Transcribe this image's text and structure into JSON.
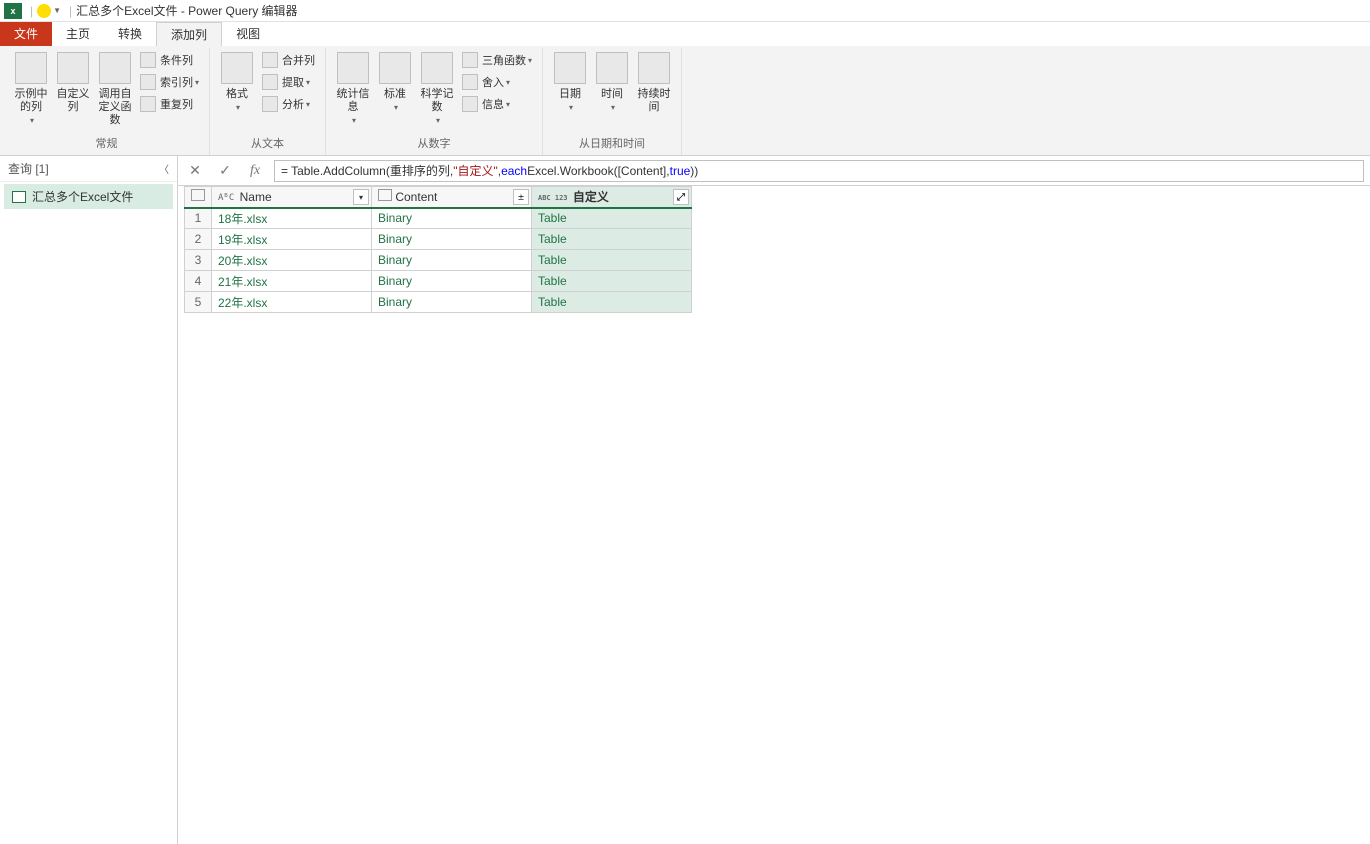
{
  "title": {
    "app_icon": "x",
    "window": "汇总多个Excel文件 - Power Query 编辑器"
  },
  "tabs": {
    "file": "文件",
    "home": "主页",
    "transform": "转换",
    "addcol": "添加列",
    "view": "视图"
  },
  "ribbon": {
    "general": {
      "label": "常规",
      "from_example": "示例中的列",
      "custom_col": "自定义列",
      "invoke_fn": "调用自定义函数",
      "cond_col": "条件列",
      "index_col": "索引列",
      "dup_col": "重复列"
    },
    "from_text": {
      "label": "从文本",
      "format": "格式",
      "merge": "合并列",
      "extract": "提取",
      "parse": "分析"
    },
    "from_number": {
      "label": "从数字",
      "stats": "统计信息",
      "standard": "标准",
      "scientific": "科学记数",
      "trig": "三角函数",
      "rounding": "舍入",
      "info": "信息"
    },
    "from_datetime": {
      "label": "从日期和时间",
      "date": "日期",
      "time": "时间",
      "duration": "持续时间"
    }
  },
  "queries": {
    "header": "查询 [1]",
    "item": "汇总多个Excel文件"
  },
  "formula": {
    "prefix": "= Table.AddColumn(重排序的列, ",
    "str": "\"自定义\"",
    "mid": ", ",
    "each": "each",
    "mid2": " Excel.Workbook([Content],",
    "bool": "true",
    "suffix": "))"
  },
  "grid": {
    "headers": {
      "name": "Name",
      "content": "Content",
      "custom": "自定义"
    },
    "type_abc": "AᴮC",
    "type_any": "ABC\n123",
    "rows": [
      {
        "n": "1",
        "name": "18年.xlsx",
        "content": "Binary",
        "custom": "Table"
      },
      {
        "n": "2",
        "name": "19年.xlsx",
        "content": "Binary",
        "custom": "Table"
      },
      {
        "n": "3",
        "name": "20年.xlsx",
        "content": "Binary",
        "custom": "Table"
      },
      {
        "n": "4",
        "name": "21年.xlsx",
        "content": "Binary",
        "custom": "Table"
      },
      {
        "n": "5",
        "name": "22年.xlsx",
        "content": "Binary",
        "custom": "Table"
      }
    ]
  }
}
